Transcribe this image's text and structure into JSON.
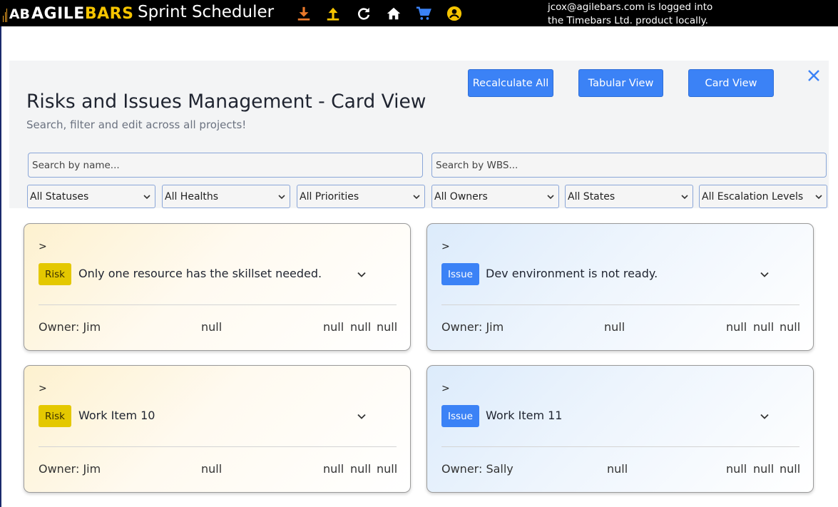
{
  "topbar": {
    "logo_mark": "AB",
    "logo_part1": "AGILE",
    "logo_part2": "BARS",
    "app_title": "Sprint Scheduler",
    "login_line1": "jcox@agilebars.com is logged into",
    "login_line2": "the Timebars Ltd. product locally.",
    "icons": [
      "download-icon",
      "upload-icon",
      "refresh-icon",
      "home-icon",
      "cart-icon",
      "account-icon"
    ],
    "colors": {
      "download": "#e8782a",
      "upload": "#f5c400",
      "refresh": "#ffffff",
      "home": "#ffffff",
      "cart": "#3b82f6",
      "account": "#f5c400"
    }
  },
  "panel": {
    "title": "Risks and Issues Management - Card View",
    "subtitle": "Search, filter and edit across all projects!",
    "buttons": {
      "recalculate": "Recalculate All",
      "tabular": "Tabular View",
      "card": "Card View"
    },
    "search_name_placeholder": "Search by name...",
    "search_wbs_placeholder": "Search by WBS...",
    "filters": {
      "status": "All Statuses",
      "health": "All Healths",
      "priority": "All Priorities",
      "owner": "All Owners",
      "state": "All States",
      "escalation": "All Escalation Levels"
    }
  },
  "cards": [
    {
      "caret": ">",
      "type": "Risk",
      "title": "Only one resource has the skillset needed.",
      "owner": "Owner: Jim",
      "v1": "null",
      "v2": "null",
      "v3": "null",
      "v4": "null"
    },
    {
      "caret": ">",
      "type": "Issue",
      "title": "Dev environment is not ready.",
      "owner": "Owner: Jim",
      "v1": "null",
      "v2": "null",
      "v3": "null",
      "v4": "null"
    },
    {
      "caret": ">",
      "type": "Risk",
      "title": "Work Item 10",
      "owner": "Owner: Jim",
      "v1": "null",
      "v2": "null",
      "v3": "null",
      "v4": "null"
    },
    {
      "caret": ">",
      "type": "Issue",
      "title": "Work Item 11",
      "owner": "Owner: Sally",
      "v1": "null",
      "v2": "null",
      "v3": "null",
      "v4": "null"
    }
  ],
  "colors": {
    "accent": "#3b82f6",
    "risk_tag": "#e4c800",
    "issue_tag": "#3b82f6",
    "topbar_bg": "#000000",
    "panel_bg": "#f3f4f5"
  }
}
